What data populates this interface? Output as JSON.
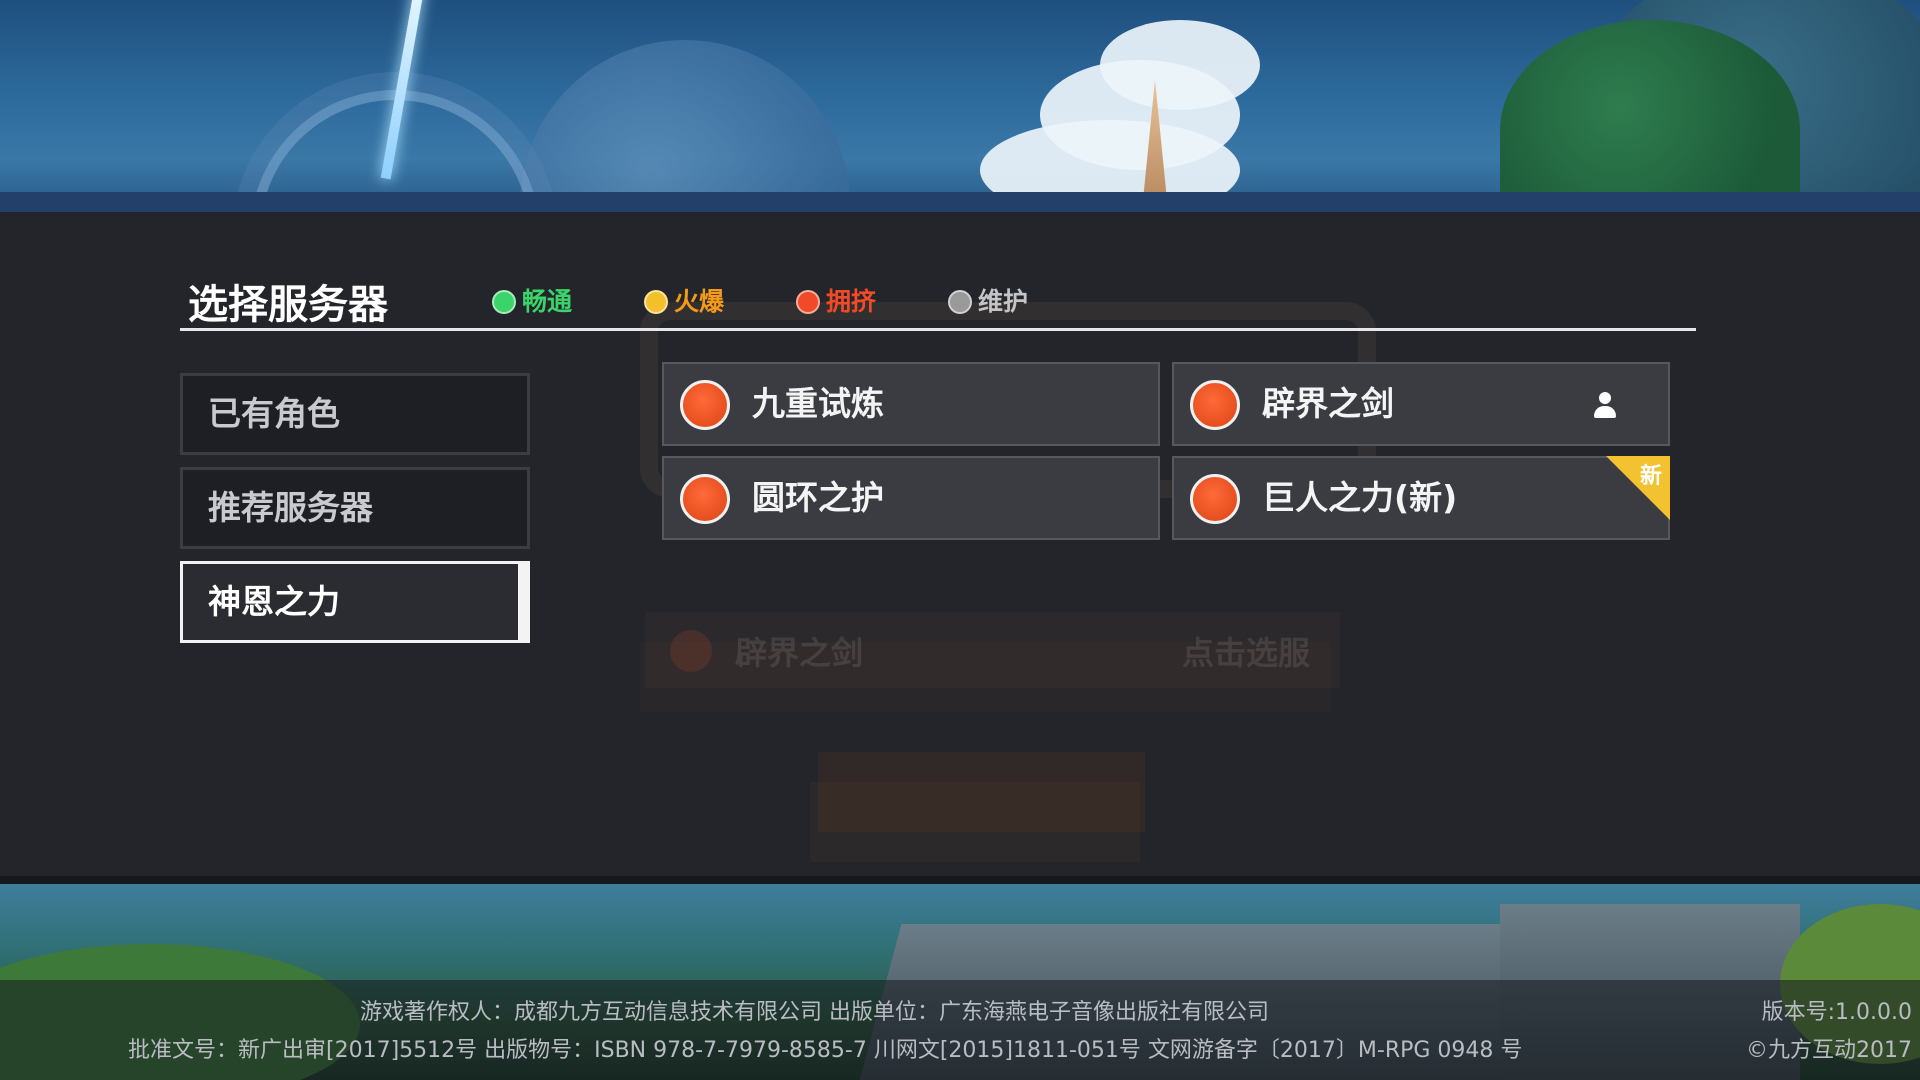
{
  "header": {
    "title": "选择服务器",
    "legend": [
      {
        "label": "畅通",
        "color": "#3bd46a"
      },
      {
        "label": "火爆",
        "color": "#f3c02b"
      },
      {
        "label": "拥挤",
        "color": "#f04a28"
      },
      {
        "label": "维护",
        "color": "#9a9a9a"
      }
    ]
  },
  "tabs": [
    {
      "label": "已有角色"
    },
    {
      "label": "推荐服务器"
    },
    {
      "label": "神恩之力"
    }
  ],
  "active_tab": "神恩之力",
  "servers": [
    {
      "name": "九重试炼",
      "status_color": "#f04a28"
    },
    {
      "name": "辟界之剑",
      "status_color": "#f04a28",
      "has_role": true
    },
    {
      "name": "圆环之护",
      "status_color": "#f04a28"
    },
    {
      "name": "巨人之力(新)",
      "status_color": "#f04a28",
      "badge": "新"
    }
  ],
  "recent": {
    "name": "辟界之剑",
    "hint": "点击选服"
  },
  "footer": {
    "line1": "游戏著作权人：成都九方互动信息技术有限公司 出版单位：广东海燕电子音像出版社有限公司",
    "line2": "批准文号：新广出审[2017]5512号 出版物号：ISBN 978-7-7979-8585-7 川网文[2015]1811-051号 文网游备字〔2017〕M-RPG 0948 号",
    "version": "版本号:1.0.0.0",
    "copyright": "©九方互动2017"
  }
}
